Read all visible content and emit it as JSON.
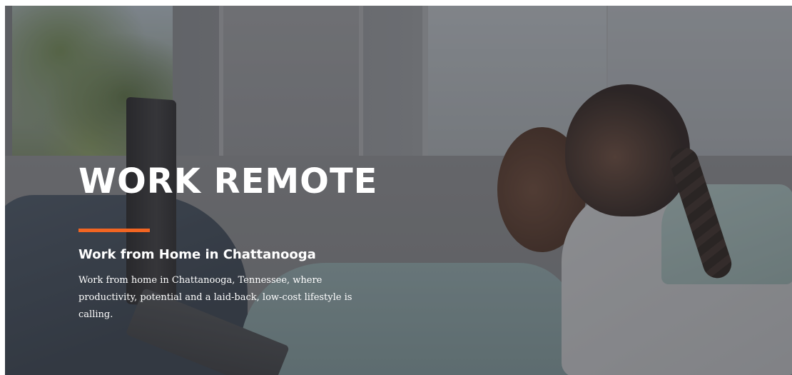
{
  "hero": {
    "title": "WORK REMOTE",
    "subtitle": "Work from Home in Chattanooga",
    "description": "Work from home in Chattanooga, Tennessee, where productivity, potential and a laid-back, low-cost lifestyle is calling.",
    "accent_color": "#f26522",
    "text_color": "#ffffff"
  }
}
